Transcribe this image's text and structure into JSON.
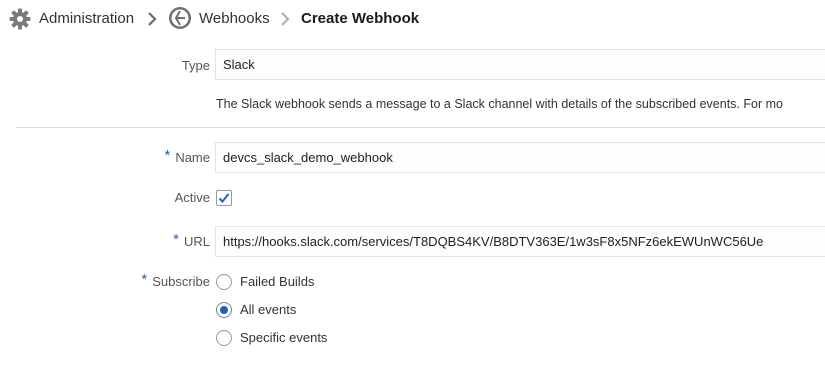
{
  "breadcrumb": {
    "administration": {
      "label": "Administration",
      "icon": "gear-icon"
    },
    "webhooks": {
      "label": "Webhooks",
      "icon": "webhook-icon"
    },
    "current": {
      "label": "Create Webhook"
    }
  },
  "form": {
    "type": {
      "label": "Type",
      "value": "Slack"
    },
    "description": "The Slack webhook sends a message to a Slack channel with details of the subscribed events. For mo",
    "name": {
      "label": "Name",
      "required_mark": "*",
      "value": "devcs_slack_demo_webhook"
    },
    "active": {
      "label": "Active",
      "checked": true
    },
    "url": {
      "label": "URL",
      "required_mark": "*",
      "value": "https://hooks.slack.com/services/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"
    },
    "subscribe": {
      "label": "Subscribe",
      "required_mark": "*",
      "options": [
        {
          "label": "Failed Builds",
          "selected": false
        },
        {
          "label": "All events",
          "selected": true
        },
        {
          "label": "Specific events",
          "selected": false
        }
      ]
    }
  },
  "colors": {
    "accent": "#1762c7",
    "required": "#1f64b0",
    "field_border": "#dfe4e8"
  }
}
